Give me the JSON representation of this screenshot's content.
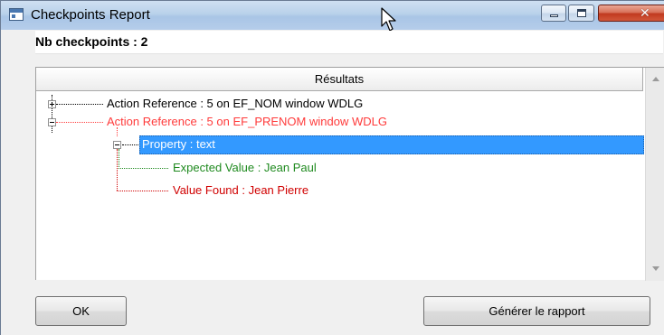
{
  "window": {
    "title": "Checkpoints Report",
    "minimize_glyph": "minimize",
    "maximize_glyph": "maximize",
    "close_glyph": "✕"
  },
  "summary": {
    "nb_checkpoints_label": "Nb checkpoints : 2"
  },
  "tree": {
    "column_header": "Résultats",
    "nodes": [
      {
        "text": "Action Reference : 5 on EF_NOM window WDLG",
        "color": "#000000",
        "expander": "plus"
      },
      {
        "text": "Action Reference : 5 on EF_PRENOM window WDLG",
        "color": "#ff3b3b",
        "expander": "minus"
      },
      {
        "text": "Property : text",
        "color": "#ffffff",
        "expander": "minus",
        "selected": true
      },
      {
        "text": "Expected Value : Jean Paul",
        "color": "#1f8a1f"
      },
      {
        "text": "Value Found : Jean Pierre",
        "color": "#d00000"
      }
    ]
  },
  "buttons": {
    "ok": "OK",
    "generate_report": "Générer le rapport"
  },
  "colors": {
    "selection": "#3399ff",
    "error_red": "#ff3b3b",
    "expected_green": "#1f8a1f",
    "found_red": "#d00000"
  }
}
